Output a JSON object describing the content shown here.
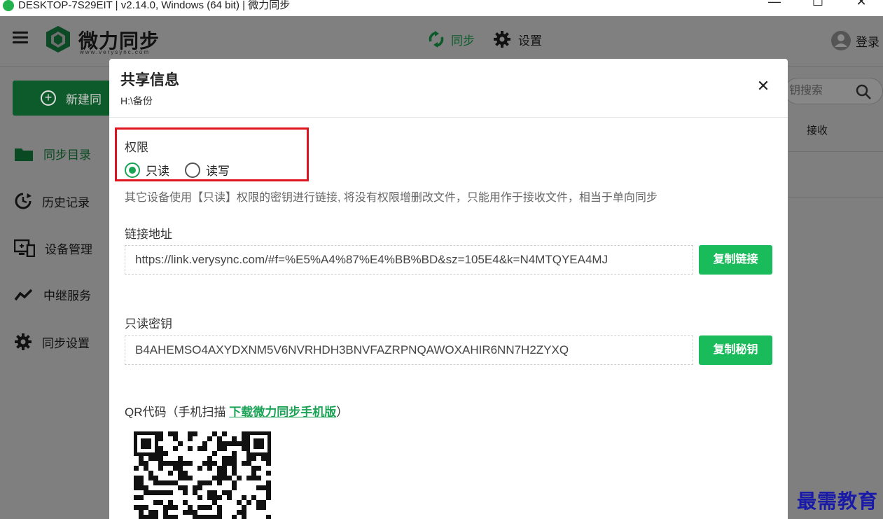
{
  "window": {
    "title": "DESKTOP-7S29EIT | v2.14.0, Windows (64 bit) | 微力同步",
    "controls": [
      "—",
      "☐",
      "✕"
    ]
  },
  "header": {
    "brand": "微力同步",
    "brand_sub": "www.verysync.com",
    "nav_sync": "同步",
    "nav_settings": "设置",
    "login": "登录"
  },
  "sidebar": {
    "new_button": "新建同",
    "items": [
      {
        "label": "同步目录",
        "icon": "folder-icon"
      },
      {
        "label": "历史记录",
        "icon": "history-icon"
      },
      {
        "label": "设备管理",
        "icon": "device-icon"
      },
      {
        "label": "中继服务",
        "icon": "relay-icon"
      },
      {
        "label": "同步设置",
        "icon": "gear-icon"
      }
    ]
  },
  "background": {
    "search_placeholder": "钥搜索",
    "column_receive": "接收"
  },
  "modal": {
    "title": "共享信息",
    "path": "H:\\备份",
    "close": "✕",
    "permission_label": "权限",
    "options": [
      {
        "label": "只读",
        "selected": true
      },
      {
        "label": "读写",
        "selected": false
      }
    ],
    "permission_desc": "其它设备使用【只读】权限的密钥进行链接, 将没有权限增删改文件，只能用作于接收文件，相当于单向同步",
    "link_label": "链接地址",
    "link_value": "https://link.verysync.com/#f=%E5%A4%87%E4%BB%BD&sz=105E4&k=N4MTQYEA4MJ",
    "copy_link": "复制链接",
    "key_label": "只读密钥",
    "key_value": "B4AHEMSO4AXYDXNM5V6NVRHDH3BNVFAZRPNQAWOXAHIR6NN7H2ZYXQ",
    "copy_key": "复制秘钥",
    "qr_prefix": "QR代码（手机扫描 ",
    "qr_link": "下载微力同步手机版",
    "qr_suffix": "）"
  },
  "watermark": "最需教育",
  "colors": {
    "accent": "#1abb5a",
    "highlight_box": "#e0141e",
    "overlay": "#7f7f7f"
  }
}
